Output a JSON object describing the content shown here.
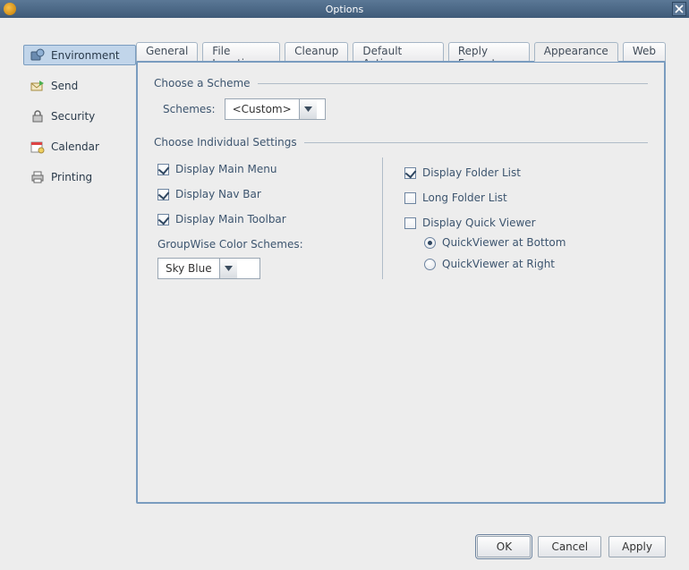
{
  "window": {
    "title": "Options"
  },
  "sidebar": {
    "items": [
      {
        "label": "Environment"
      },
      {
        "label": "Send"
      },
      {
        "label": "Security"
      },
      {
        "label": "Calendar"
      },
      {
        "label": "Printing"
      }
    ]
  },
  "tabs": [
    {
      "label": "General"
    },
    {
      "label": "File Location"
    },
    {
      "label": "Cleanup"
    },
    {
      "label": "Default Actions"
    },
    {
      "label": "Reply Format"
    },
    {
      "label": "Appearance"
    },
    {
      "label": "Web"
    }
  ],
  "scheme_group": {
    "heading": "Choose a Scheme",
    "label": "Schemes:",
    "value": "<Custom>"
  },
  "settings_group": {
    "heading": "Choose Individual Settings"
  },
  "left_checks": {
    "main_menu": "Display Main Menu",
    "nav_bar": "Display Nav Bar",
    "main_toolbar": "Display Main Toolbar",
    "color_scheme_label": "GroupWise Color Schemes:",
    "color_scheme_value": "Sky Blue"
  },
  "right_checks": {
    "folder_list": "Display Folder List",
    "long_folder_list": "Long Folder List",
    "quick_viewer": "Display Quick Viewer",
    "qv_bottom": "QuickViewer at Bottom",
    "qv_right": "QuickViewer at Right"
  },
  "buttons": {
    "ok": "OK",
    "cancel": "Cancel",
    "apply": "Apply"
  }
}
